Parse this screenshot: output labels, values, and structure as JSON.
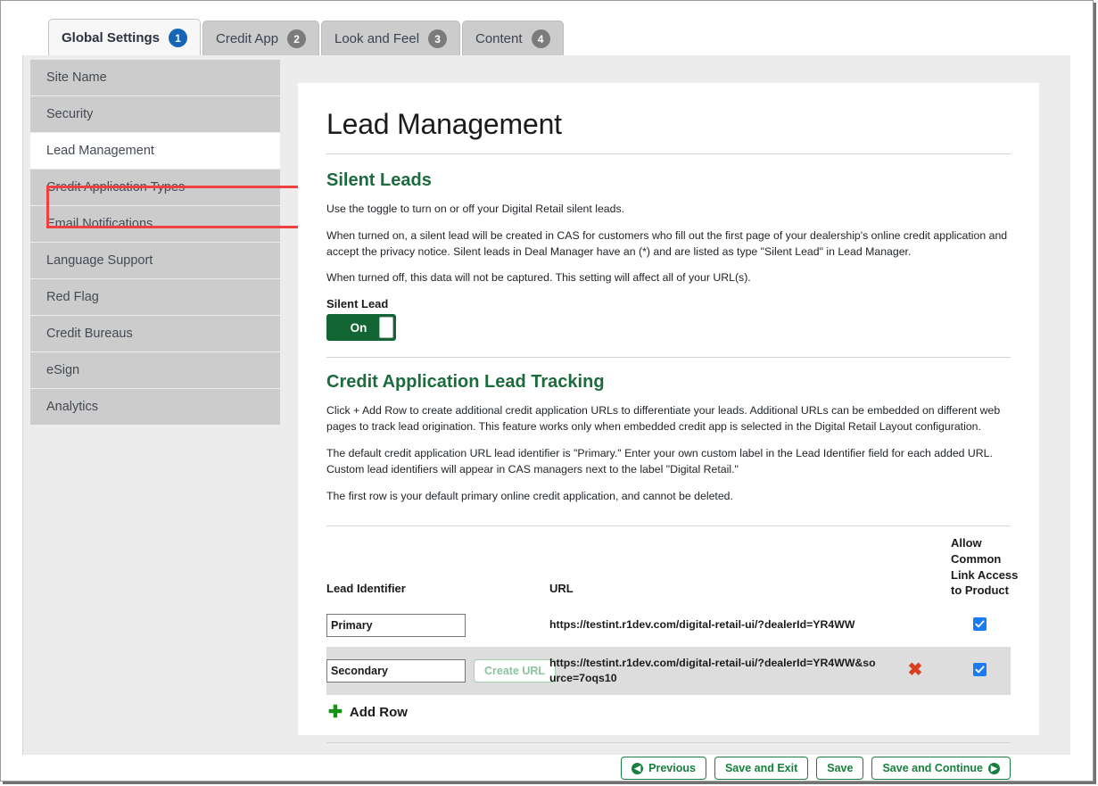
{
  "tabs": [
    {
      "label": "Global Settings",
      "badge": "1",
      "active": true,
      "badge_color": "#1566b7"
    },
    {
      "label": "Credit App",
      "badge": "2",
      "active": false,
      "badge_color": "#7b7b7b"
    },
    {
      "label": "Look and Feel",
      "badge": "3",
      "active": false,
      "badge_color": "#7b7b7b"
    },
    {
      "label": "Content",
      "badge": "4",
      "active": false,
      "badge_color": "#7b7b7b"
    }
  ],
  "sidebar": {
    "items": [
      {
        "label": "Site Name",
        "active": false
      },
      {
        "label": "Security",
        "active": false
      },
      {
        "label": "Lead Management",
        "active": true
      },
      {
        "label": "Credit Application Types",
        "active": false
      },
      {
        "label": "Email Notifications",
        "active": false
      },
      {
        "label": "Language Support",
        "active": false
      },
      {
        "label": "Red Flag",
        "active": false
      },
      {
        "label": "Credit Bureaus",
        "active": false
      },
      {
        "label": "eSign",
        "active": false
      },
      {
        "label": "Analytics",
        "active": false
      }
    ],
    "highlight_color": "#f0403f"
  },
  "main": {
    "page_title": "Lead Management",
    "silent_leads": {
      "heading": "Silent Leads",
      "p1": "Use the toggle to turn on or off your Digital Retail silent leads.",
      "p2": "When turned on, a silent lead will be created in CAS for customers who fill out the first page of your dealership's online credit application and accept the privacy notice. Silent leads in Deal Manager have an (*) and are listed as type \"Silent Lead\" in Lead Manager.",
      "p3": "When turned off, this data will not be captured. This setting will affect all of your URL(s).",
      "toggle_label": "Silent Lead",
      "toggle_state": "On",
      "toggle_color": "#116633"
    },
    "lead_tracking": {
      "heading": "Credit Application Lead Tracking",
      "p1": "Click + Add Row to create additional credit application URLs to differentiate your leads. Additional URLs can be embedded on different web pages to track lead origination. This feature works only when embedded credit app is selected in the Digital Retail Layout configuration.",
      "p2": "The default credit application URL lead identifier is \"Primary.\" Enter your own custom label in the Lead Identifier field for each added URL. Custom lead identifiers will appear in CAS managers next to the label \"Digital Retail.\"",
      "p3": "The first row is your default primary online credit application, and cannot be deleted.",
      "table": {
        "headers": {
          "lead_identifier": "Lead Identifier",
          "url": "URL",
          "allow_common": "Allow Common Link Access to Product"
        },
        "rows": [
          {
            "identifier": "Primary",
            "identifier_placeholder": "Lead Identifier",
            "create_url_label": "",
            "has_create_url": false,
            "url": "https://testint.r1dev.com/digital-retail-ui/?dealerId=YR4WW",
            "deletable": false,
            "delete_icon": "x-icon",
            "allow_common_checked": true,
            "shaded": false
          },
          {
            "identifier": "Secondary",
            "identifier_placeholder": "Lead Identifier",
            "create_url_label": "Create URL",
            "has_create_url": true,
            "url": "https://testint.r1dev.com/digital-retail-ui/?dealerId=YR4WW&source=7oqs10",
            "deletable": true,
            "delete_icon": "x-icon",
            "allow_common_checked": true,
            "shaded": true
          }
        ]
      },
      "add_row_label": "Add Row",
      "add_row_icon": "plus-icon"
    },
    "footer": {
      "previous": "Previous",
      "save_and_exit": "Save and Exit",
      "save": "Save",
      "save_and_continue": "Save and Continue",
      "accent_color": "#17803f"
    }
  }
}
